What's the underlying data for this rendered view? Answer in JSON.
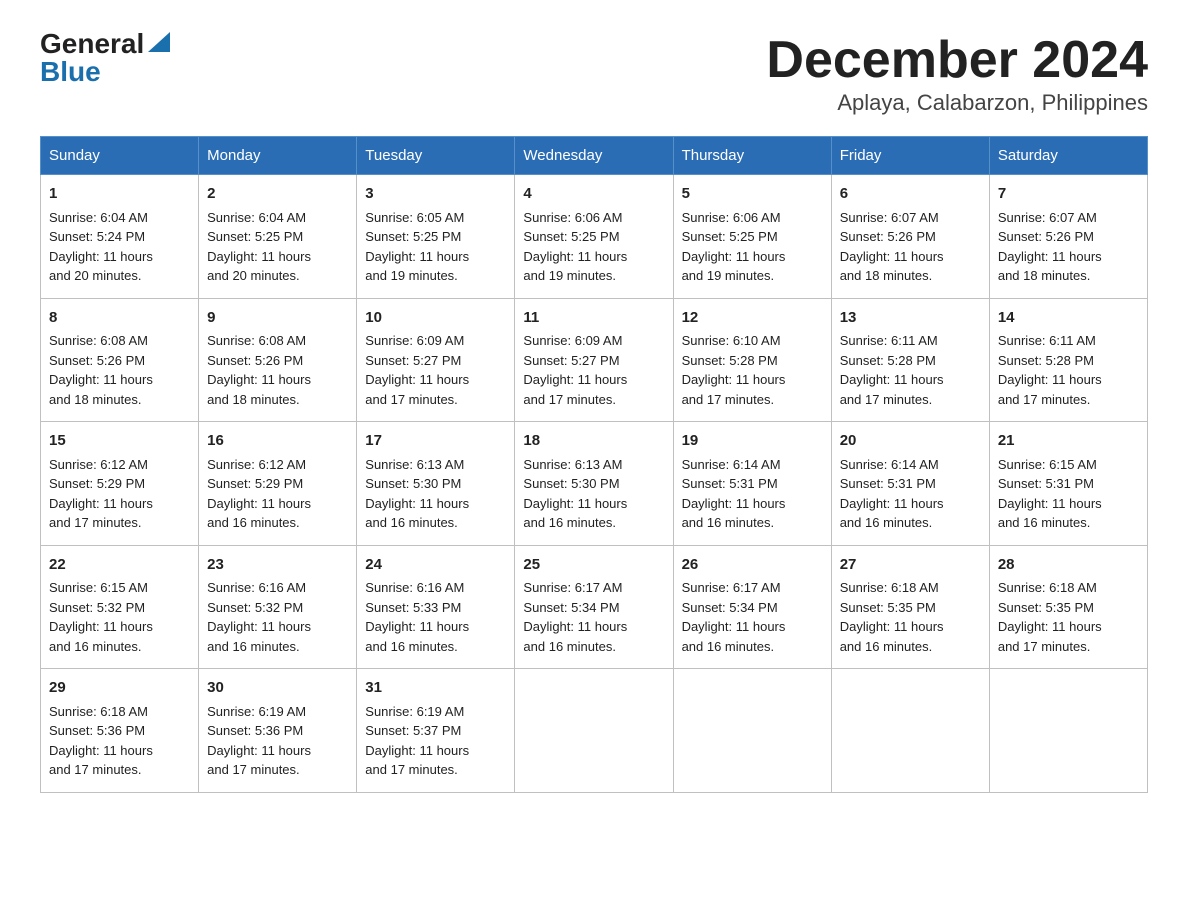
{
  "logo": {
    "general": "General",
    "blue": "Blue"
  },
  "title": "December 2024",
  "subtitle": "Aplaya, Calabarzon, Philippines",
  "weekdays": [
    "Sunday",
    "Monday",
    "Tuesday",
    "Wednesday",
    "Thursday",
    "Friday",
    "Saturday"
  ],
  "days": [
    {
      "num": "1",
      "sunrise": "6:04 AM",
      "sunset": "5:24 PM",
      "daylight": "11 hours and 20 minutes."
    },
    {
      "num": "2",
      "sunrise": "6:04 AM",
      "sunset": "5:25 PM",
      "daylight": "11 hours and 20 minutes."
    },
    {
      "num": "3",
      "sunrise": "6:05 AM",
      "sunset": "5:25 PM",
      "daylight": "11 hours and 19 minutes."
    },
    {
      "num": "4",
      "sunrise": "6:06 AM",
      "sunset": "5:25 PM",
      "daylight": "11 hours and 19 minutes."
    },
    {
      "num": "5",
      "sunrise": "6:06 AM",
      "sunset": "5:25 PM",
      "daylight": "11 hours and 19 minutes."
    },
    {
      "num": "6",
      "sunrise": "6:07 AM",
      "sunset": "5:26 PM",
      "daylight": "11 hours and 18 minutes."
    },
    {
      "num": "7",
      "sunrise": "6:07 AM",
      "sunset": "5:26 PM",
      "daylight": "11 hours and 18 minutes."
    },
    {
      "num": "8",
      "sunrise": "6:08 AM",
      "sunset": "5:26 PM",
      "daylight": "11 hours and 18 minutes."
    },
    {
      "num": "9",
      "sunrise": "6:08 AM",
      "sunset": "5:26 PM",
      "daylight": "11 hours and 18 minutes."
    },
    {
      "num": "10",
      "sunrise": "6:09 AM",
      "sunset": "5:27 PM",
      "daylight": "11 hours and 17 minutes."
    },
    {
      "num": "11",
      "sunrise": "6:09 AM",
      "sunset": "5:27 PM",
      "daylight": "11 hours and 17 minutes."
    },
    {
      "num": "12",
      "sunrise": "6:10 AM",
      "sunset": "5:28 PM",
      "daylight": "11 hours and 17 minutes."
    },
    {
      "num": "13",
      "sunrise": "6:11 AM",
      "sunset": "5:28 PM",
      "daylight": "11 hours and 17 minutes."
    },
    {
      "num": "14",
      "sunrise": "6:11 AM",
      "sunset": "5:28 PM",
      "daylight": "11 hours and 17 minutes."
    },
    {
      "num": "15",
      "sunrise": "6:12 AM",
      "sunset": "5:29 PM",
      "daylight": "11 hours and 17 minutes."
    },
    {
      "num": "16",
      "sunrise": "6:12 AM",
      "sunset": "5:29 PM",
      "daylight": "11 hours and 16 minutes."
    },
    {
      "num": "17",
      "sunrise": "6:13 AM",
      "sunset": "5:30 PM",
      "daylight": "11 hours and 16 minutes."
    },
    {
      "num": "18",
      "sunrise": "6:13 AM",
      "sunset": "5:30 PM",
      "daylight": "11 hours and 16 minutes."
    },
    {
      "num": "19",
      "sunrise": "6:14 AM",
      "sunset": "5:31 PM",
      "daylight": "11 hours and 16 minutes."
    },
    {
      "num": "20",
      "sunrise": "6:14 AM",
      "sunset": "5:31 PM",
      "daylight": "11 hours and 16 minutes."
    },
    {
      "num": "21",
      "sunrise": "6:15 AM",
      "sunset": "5:31 PM",
      "daylight": "11 hours and 16 minutes."
    },
    {
      "num": "22",
      "sunrise": "6:15 AM",
      "sunset": "5:32 PM",
      "daylight": "11 hours and 16 minutes."
    },
    {
      "num": "23",
      "sunrise": "6:16 AM",
      "sunset": "5:32 PM",
      "daylight": "11 hours and 16 minutes."
    },
    {
      "num": "24",
      "sunrise": "6:16 AM",
      "sunset": "5:33 PM",
      "daylight": "11 hours and 16 minutes."
    },
    {
      "num": "25",
      "sunrise": "6:17 AM",
      "sunset": "5:34 PM",
      "daylight": "11 hours and 16 minutes."
    },
    {
      "num": "26",
      "sunrise": "6:17 AM",
      "sunset": "5:34 PM",
      "daylight": "11 hours and 16 minutes."
    },
    {
      "num": "27",
      "sunrise": "6:18 AM",
      "sunset": "5:35 PM",
      "daylight": "11 hours and 16 minutes."
    },
    {
      "num": "28",
      "sunrise": "6:18 AM",
      "sunset": "5:35 PM",
      "daylight": "11 hours and 17 minutes."
    },
    {
      "num": "29",
      "sunrise": "6:18 AM",
      "sunset": "5:36 PM",
      "daylight": "11 hours and 17 minutes."
    },
    {
      "num": "30",
      "sunrise": "6:19 AM",
      "sunset": "5:36 PM",
      "daylight": "11 hours and 17 minutes."
    },
    {
      "num": "31",
      "sunrise": "6:19 AM",
      "sunset": "5:37 PM",
      "daylight": "11 hours and 17 minutes."
    }
  ],
  "labels": {
    "sunrise": "Sunrise:",
    "sunset": "Sunset:",
    "daylight": "Daylight:"
  }
}
